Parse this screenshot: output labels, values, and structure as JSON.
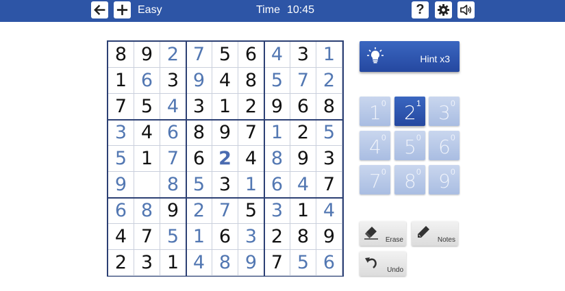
{
  "topbar": {
    "back_icon": "arrow-left-icon",
    "new_icon": "plus-icon",
    "difficulty": "Easy",
    "time_label": "Time",
    "time_value": "10:45",
    "help_label": "?",
    "settings_icon": "gear-icon",
    "sound_icon": "speaker-icon"
  },
  "board": {
    "rows": [
      [
        {
          "v": "8",
          "t": "given"
        },
        {
          "v": "9",
          "t": "given"
        },
        {
          "v": "2",
          "t": "user"
        },
        {
          "v": "7",
          "t": "user"
        },
        {
          "v": "5",
          "t": "given"
        },
        {
          "v": "6",
          "t": "given"
        },
        {
          "v": "4",
          "t": "user"
        },
        {
          "v": "3",
          "t": "given"
        },
        {
          "v": "1",
          "t": "user"
        }
      ],
      [
        {
          "v": "1",
          "t": "given"
        },
        {
          "v": "6",
          "t": "user"
        },
        {
          "v": "3",
          "t": "given"
        },
        {
          "v": "9",
          "t": "user"
        },
        {
          "v": "4",
          "t": "given"
        },
        {
          "v": "8",
          "t": "given"
        },
        {
          "v": "5",
          "t": "user"
        },
        {
          "v": "7",
          "t": "user"
        },
        {
          "v": "2",
          "t": "user"
        }
      ],
      [
        {
          "v": "7",
          "t": "given"
        },
        {
          "v": "5",
          "t": "given"
        },
        {
          "v": "4",
          "t": "user"
        },
        {
          "v": "3",
          "t": "given"
        },
        {
          "v": "1",
          "t": "given"
        },
        {
          "v": "2",
          "t": "given"
        },
        {
          "v": "9",
          "t": "given"
        },
        {
          "v": "6",
          "t": "given"
        },
        {
          "v": "8",
          "t": "given"
        }
      ],
      [
        {
          "v": "3",
          "t": "user"
        },
        {
          "v": "4",
          "t": "given"
        },
        {
          "v": "6",
          "t": "user"
        },
        {
          "v": "8",
          "t": "given"
        },
        {
          "v": "9",
          "t": "given"
        },
        {
          "v": "7",
          "t": "given"
        },
        {
          "v": "1",
          "t": "user"
        },
        {
          "v": "2",
          "t": "given"
        },
        {
          "v": "5",
          "t": "user"
        }
      ],
      [
        {
          "v": "5",
          "t": "user"
        },
        {
          "v": "1",
          "t": "given"
        },
        {
          "v": "7",
          "t": "user"
        },
        {
          "v": "6",
          "t": "given"
        },
        {
          "v": "2",
          "t": "bold"
        },
        {
          "v": "4",
          "t": "given"
        },
        {
          "v": "8",
          "t": "user"
        },
        {
          "v": "9",
          "t": "given"
        },
        {
          "v": "3",
          "t": "given"
        }
      ],
      [
        {
          "v": "9",
          "t": "user"
        },
        {
          "v": "",
          "t": "empty"
        },
        {
          "v": "8",
          "t": "user"
        },
        {
          "v": "5",
          "t": "user"
        },
        {
          "v": "3",
          "t": "given"
        },
        {
          "v": "1",
          "t": "user"
        },
        {
          "v": "6",
          "t": "user"
        },
        {
          "v": "4",
          "t": "user"
        },
        {
          "v": "7",
          "t": "given"
        }
      ],
      [
        {
          "v": "6",
          "t": "user"
        },
        {
          "v": "8",
          "t": "user"
        },
        {
          "v": "9",
          "t": "given"
        },
        {
          "v": "2",
          "t": "user"
        },
        {
          "v": "7",
          "t": "user"
        },
        {
          "v": "5",
          "t": "given"
        },
        {
          "v": "3",
          "t": "user"
        },
        {
          "v": "1",
          "t": "given"
        },
        {
          "v": "4",
          "t": "user"
        }
      ],
      [
        {
          "v": "4",
          "t": "given"
        },
        {
          "v": "7",
          "t": "given"
        },
        {
          "v": "5",
          "t": "user"
        },
        {
          "v": "1",
          "t": "user"
        },
        {
          "v": "6",
          "t": "given"
        },
        {
          "v": "3",
          "t": "user"
        },
        {
          "v": "2",
          "t": "given"
        },
        {
          "v": "8",
          "t": "given"
        },
        {
          "v": "9",
          "t": "given"
        }
      ],
      [
        {
          "v": "2",
          "t": "given"
        },
        {
          "v": "3",
          "t": "given"
        },
        {
          "v": "1",
          "t": "given"
        },
        {
          "v": "4",
          "t": "user"
        },
        {
          "v": "8",
          "t": "user"
        },
        {
          "v": "9",
          "t": "user"
        },
        {
          "v": "7",
          "t": "given"
        },
        {
          "v": "5",
          "t": "user"
        },
        {
          "v": "6",
          "t": "user"
        }
      ]
    ]
  },
  "hint": {
    "label": "Hint x3",
    "icon": "lightbulb-icon"
  },
  "numpad": [
    {
      "digit": "1",
      "count": "0",
      "active": false
    },
    {
      "digit": "2",
      "count": "1",
      "active": true
    },
    {
      "digit": "3",
      "count": "0",
      "active": false
    },
    {
      "digit": "4",
      "count": "0",
      "active": false
    },
    {
      "digit": "5",
      "count": "0",
      "active": false
    },
    {
      "digit": "6",
      "count": "0",
      "active": false
    },
    {
      "digit": "7",
      "count": "0",
      "active": false
    },
    {
      "digit": "8",
      "count": "0",
      "active": false
    },
    {
      "digit": "9",
      "count": "0",
      "active": false
    }
  ],
  "tools": {
    "erase_label": "Erase",
    "notes_label": "Notes",
    "undo_label": "Undo"
  },
  "colors": {
    "topbar": "#2d55a6",
    "given_digit": "#111111",
    "user_digit": "#5277b2",
    "grid_thick": "#2b3f73"
  }
}
